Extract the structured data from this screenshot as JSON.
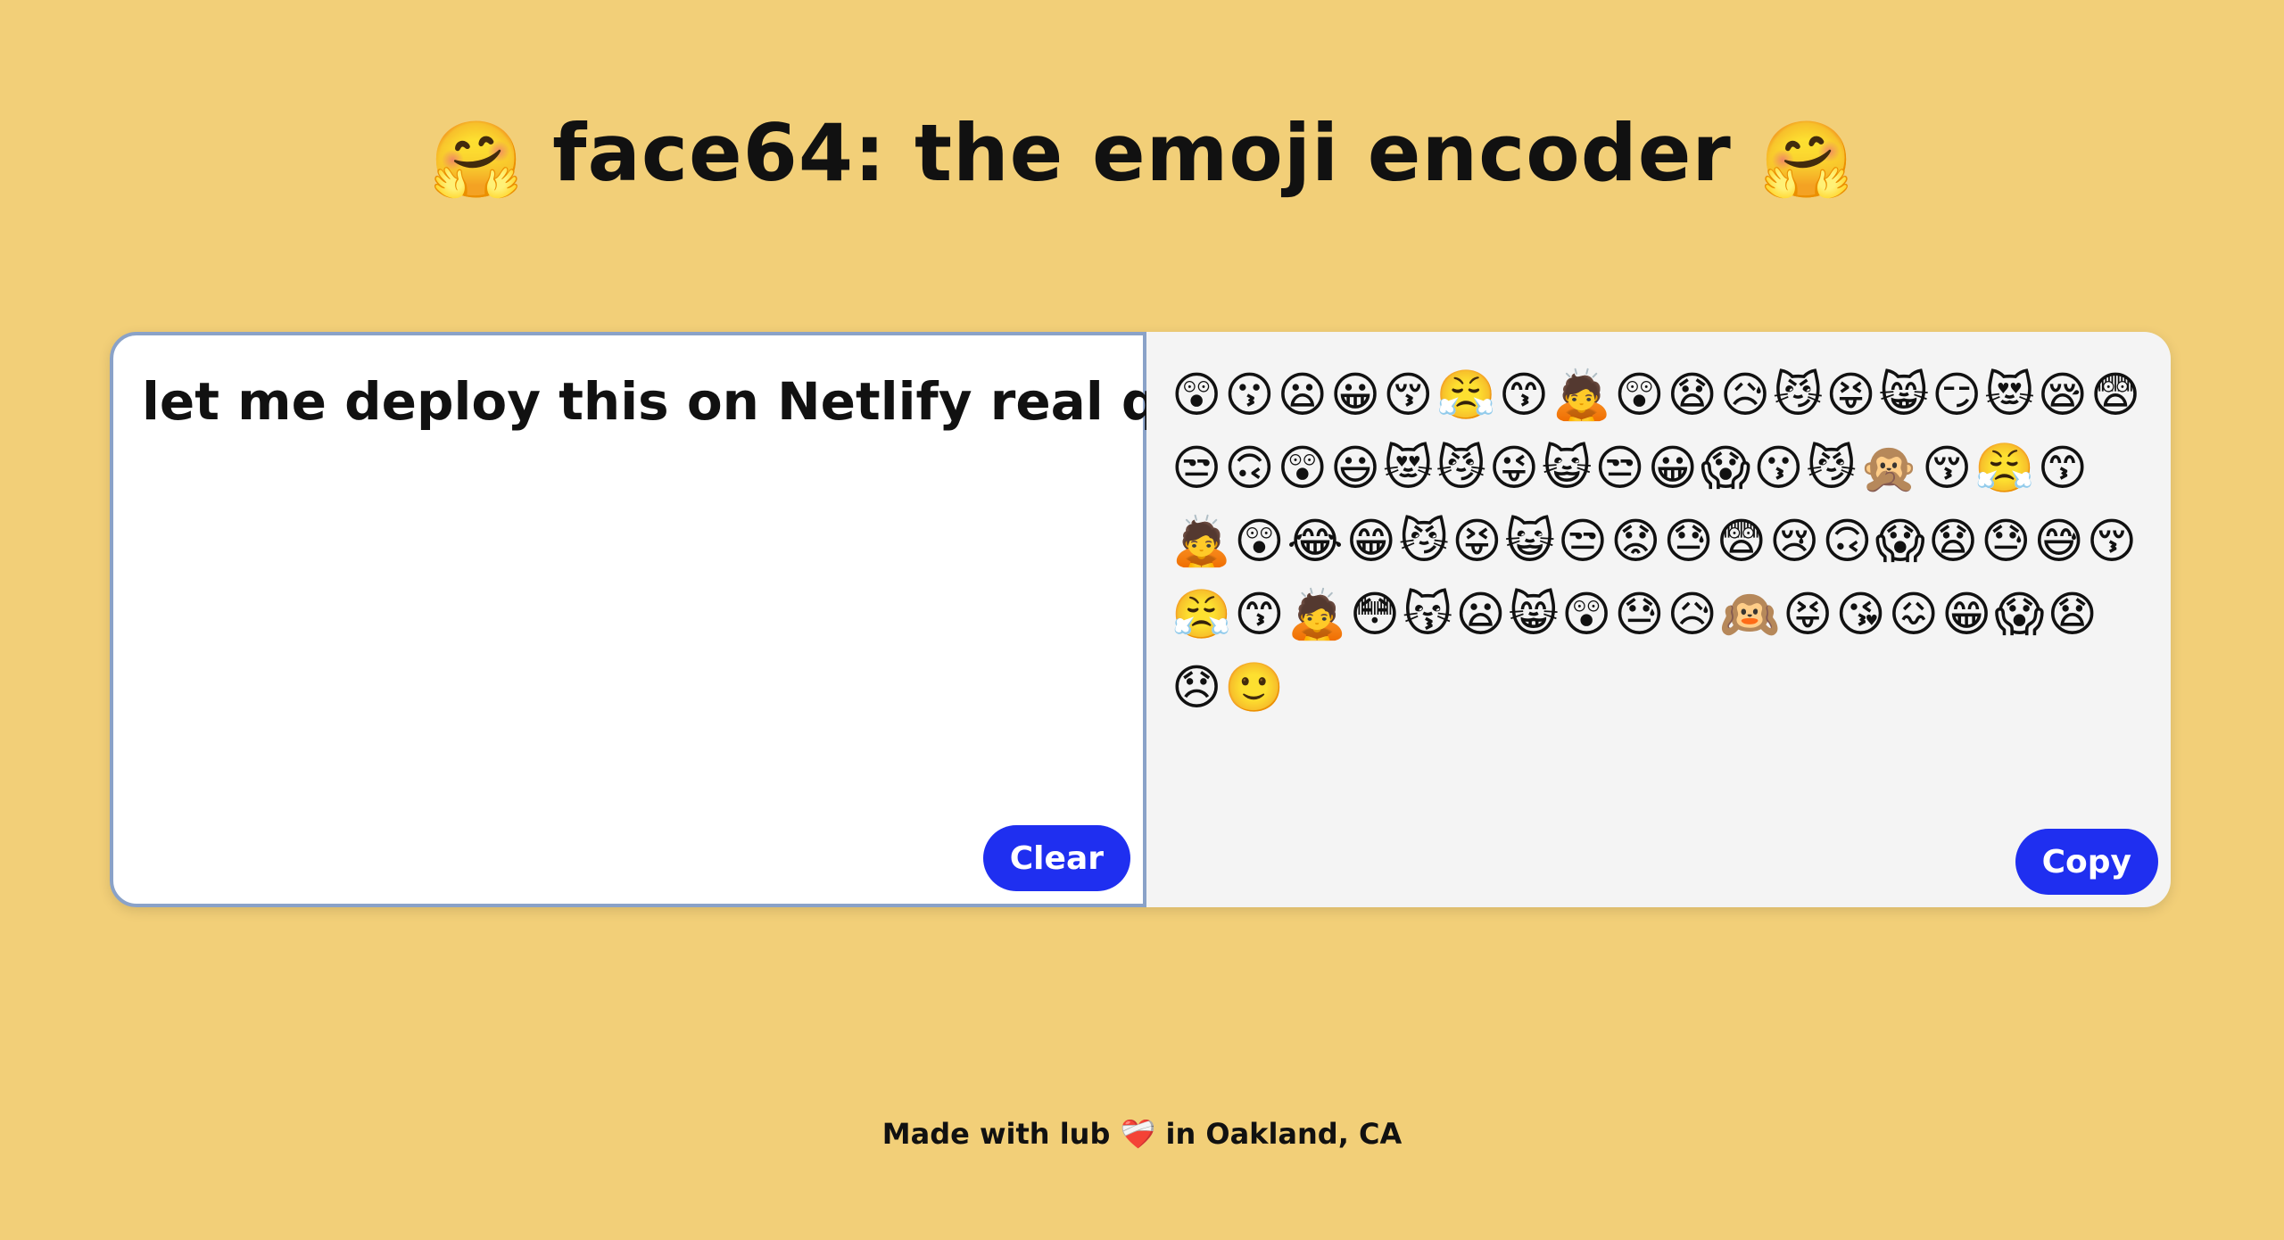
{
  "header": {
    "emoji_left": "🤗",
    "title": "face64: the emoji encoder",
    "emoji_right": "🤗"
  },
  "input": {
    "value": "let me deploy this on Netlify real quick",
    "clear_label": "Clear"
  },
  "output": {
    "emojis": "😲😗😦😀😚😤😙🙇😲😧😥😼😝😸😏😻😪😨😒🙃😲😃😻😼😜😺😒😀😱😗😼🙊😚😤😙🙇😲😂😁😼😝😺😒😟😓😨😢🙃😱😧😓😅😚😤😙🙇😳😽😦😸😲😓😥🙉😝😘😖😁😱😧😞🙂",
    "copy_label": "Copy"
  },
  "footer": {
    "prefix": "Made with lub",
    "heart": "❤️‍🩹",
    "suffix": "in Oakland, CA"
  },
  "colors": {
    "background": "#f2cf78",
    "button": "#1f2ff0",
    "input_border": "#8aa2c8",
    "output_background": "#f4f4f4"
  }
}
